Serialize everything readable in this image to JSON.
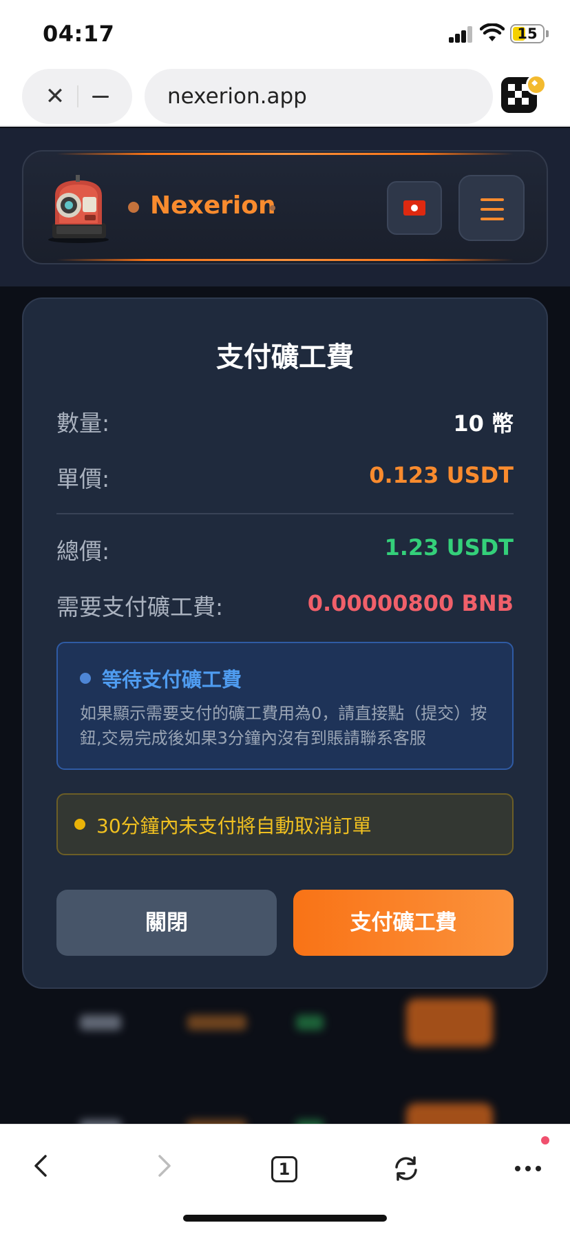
{
  "status": {
    "time": "04:17",
    "battery": "15"
  },
  "browser": {
    "url": "nexerion.app",
    "tab_count": "1"
  },
  "header": {
    "brand": "Nexerion"
  },
  "modal": {
    "title": "支付礦工費",
    "rows": [
      {
        "label": "數量:",
        "value": "10 幣",
        "color": "#ffffff"
      },
      {
        "label": "單價:",
        "value": "0.123 USDT",
        "color": "#f98b2e"
      },
      {
        "label": "總價:",
        "value": "1.23 USDT",
        "color": "#34d07a"
      },
      {
        "label": "需要支付礦工費:",
        "value": "0.00000800 BNB",
        "color": "#f0606a"
      }
    ],
    "info": {
      "title": "等待支付礦工費",
      "text": "如果顯示需要支付的礦工費用為0，請直接點（提交）按鈕,交易完成後如果3分鐘內沒有到賬請聯系客服"
    },
    "warning": "30分鐘內未支付將自動取消訂單",
    "buttons": {
      "close": "關閉",
      "pay": "支付礦工費"
    }
  },
  "colors": {
    "accent": "#f97316",
    "modal_bg": "#1f2a3d",
    "total": "#34d07a",
    "fee": "#f0606a"
  }
}
